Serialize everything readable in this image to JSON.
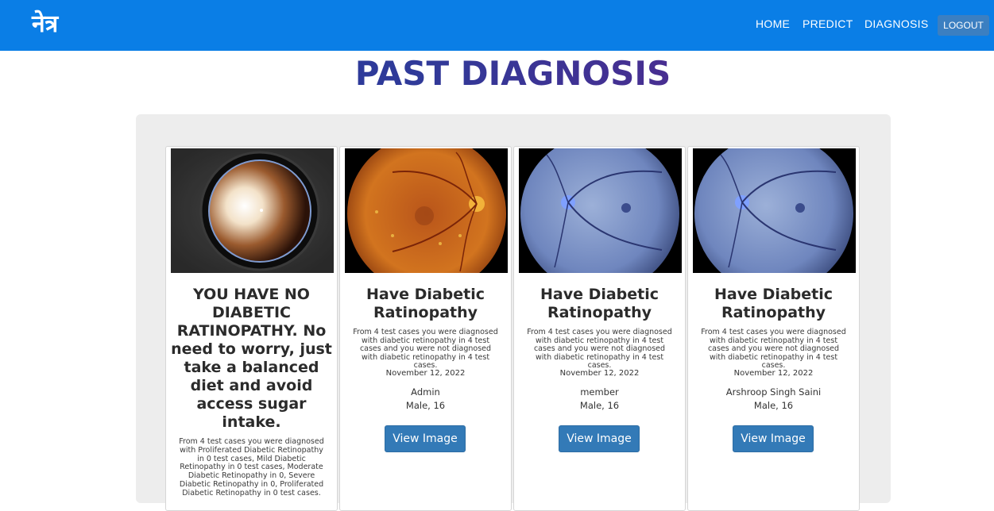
{
  "navbar": {
    "brand": "नेत्र",
    "links": [
      "HOME",
      "PREDICT",
      "DIAGNOSIS"
    ],
    "logout_label": "LOGOUT",
    "background": "#0a7ee6"
  },
  "page": {
    "title": "PAST DIAGNOSIS"
  },
  "cards": [
    {
      "heading": "YOU HAVE NO DIABETIC RATINOPATHY. No need to worry, just take a balanced diet and avoid access sugar intake.",
      "description": "From 4 test cases you were diagnosed with Proliferated Diabetic Retinopathy in 0 test cases, Mild Diabetic Retinopathy in 0 test cases, Moderate Diabetic Retinopathy in 0, Severe Diabetic Retinopathy in 0, Proliferated Diabetic Retinopathy in 0 test cases.",
      "image_icon": "eye-lens-image"
    },
    {
      "heading": "Have Diabetic Ratinopathy",
      "description": "From 4 test cases you were diagnosed with diabetic retinopathy in 4 test cases and you were not diagnosed with diabetic retinopathy in 4 test cases.",
      "date": "November 12, 2022",
      "name": "Admin",
      "info": "Male, 16",
      "button_label": "View Image",
      "image_icon": "retina-orange-image"
    },
    {
      "heading": "Have Diabetic Ratinopathy",
      "description": "From 4 test cases you were diagnosed with diabetic retinopathy in 4 test cases and you were not diagnosed with diabetic retinopathy in 4 test cases.",
      "date": "November 12, 2022",
      "name": "member",
      "info": "Male, 16",
      "button_label": "View Image",
      "image_icon": "retina-blue-image"
    },
    {
      "heading": "Have Diabetic Ratinopathy",
      "description": "From 4 test cases you were diagnosed with diabetic retinopathy in 4 test cases and you were not diagnosed with diabetic retinopathy in 4 test cases.",
      "date": "November 12, 2022",
      "name": "Arshroop Singh Saini",
      "info": "Male, 16",
      "button_label": "View Image",
      "image_icon": "retina-blue-image"
    }
  ]
}
